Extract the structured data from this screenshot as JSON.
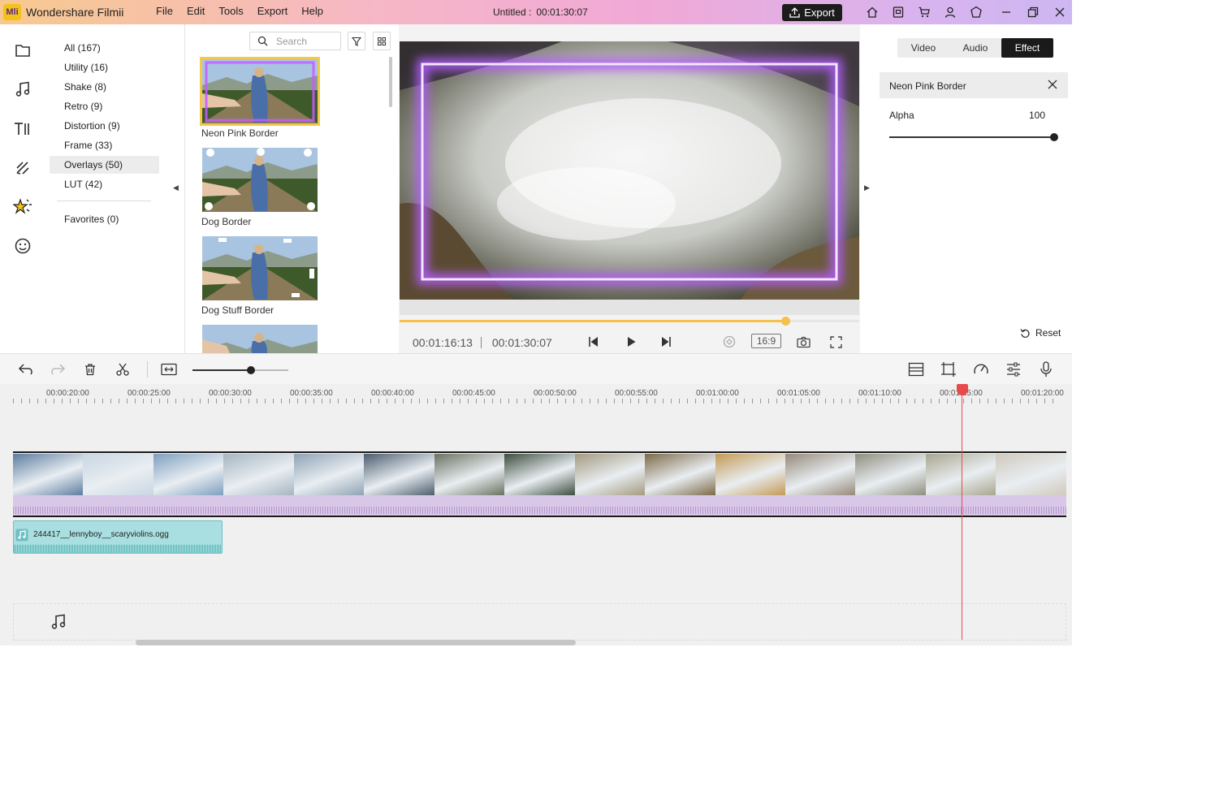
{
  "app": {
    "logo_text": "Mli",
    "name": "Wondershare Filmii",
    "menu": [
      "File",
      "Edit",
      "Tools",
      "Export",
      "Help"
    ],
    "doc_title": "Untitled :",
    "doc_duration": "00:01:30:07",
    "export_label": "Export",
    "title_icons": [
      "home-icon",
      "save-icon",
      "cart-icon",
      "account-icon",
      "gift-icon"
    ],
    "window_controls": [
      "minimize-icon",
      "restore-icon",
      "close-icon"
    ]
  },
  "rail": {
    "items": [
      "media-icon",
      "audio-icon",
      "titles-icon",
      "transitions-icon",
      "effects-icon",
      "elements-icon"
    ],
    "active": "effects-icon"
  },
  "categories": {
    "items": [
      "All (167)",
      "Utility (16)",
      "Shake (8)",
      "Retro (9)",
      "Distortion (9)",
      "Frame (33)",
      "Overlays (50)",
      "LUT (42)"
    ],
    "selected_index": 6,
    "favorites": "Favorites (0)"
  },
  "library": {
    "search_placeholder": "Search",
    "items": [
      "Neon Pink Border",
      "Dog Border",
      "Dog Stuff Border"
    ],
    "selected_index": 0
  },
  "preview": {
    "current_time": "00:01:16:13",
    "total_time": "00:01:30:07",
    "progress": 0.84,
    "aspect_ratio": "16:9"
  },
  "properties": {
    "tabs": [
      "Video",
      "Audio",
      "Effect"
    ],
    "active_tab": "Effect",
    "effect_name": "Neon Pink Border",
    "alpha_label": "Alpha",
    "alpha_value": "100",
    "reset_label": "Reset"
  },
  "timeline": {
    "ruler_labels": [
      "00:00:20:00",
      "00:00:25:00",
      "00:00:30:00",
      "00:00:35:00",
      "00:00:40:00",
      "00:00:45:00",
      "00:00:50:00",
      "00:00:55:00",
      "00:01:00:00",
      "00:01:05:00",
      "00:01:10:00",
      "00:01:15:00",
      "00:01:20:00"
    ],
    "zoom_level": 0.61,
    "audio_clip_name": "244417__lennyboy__scaryviolins.ogg",
    "frame_colors": [
      "#5d7da0",
      "#c8d6e2",
      "#7e9fbf",
      "#a6b5c1",
      "#8fa3b4",
      "#4b5d6e",
      "#6b7261",
      "#3d4d3f",
      "#a49a80",
      "#7d6a48",
      "#c39a55",
      "#96897a",
      "#8f8f7f",
      "#a9a690",
      "#d0c9bd"
    ]
  }
}
